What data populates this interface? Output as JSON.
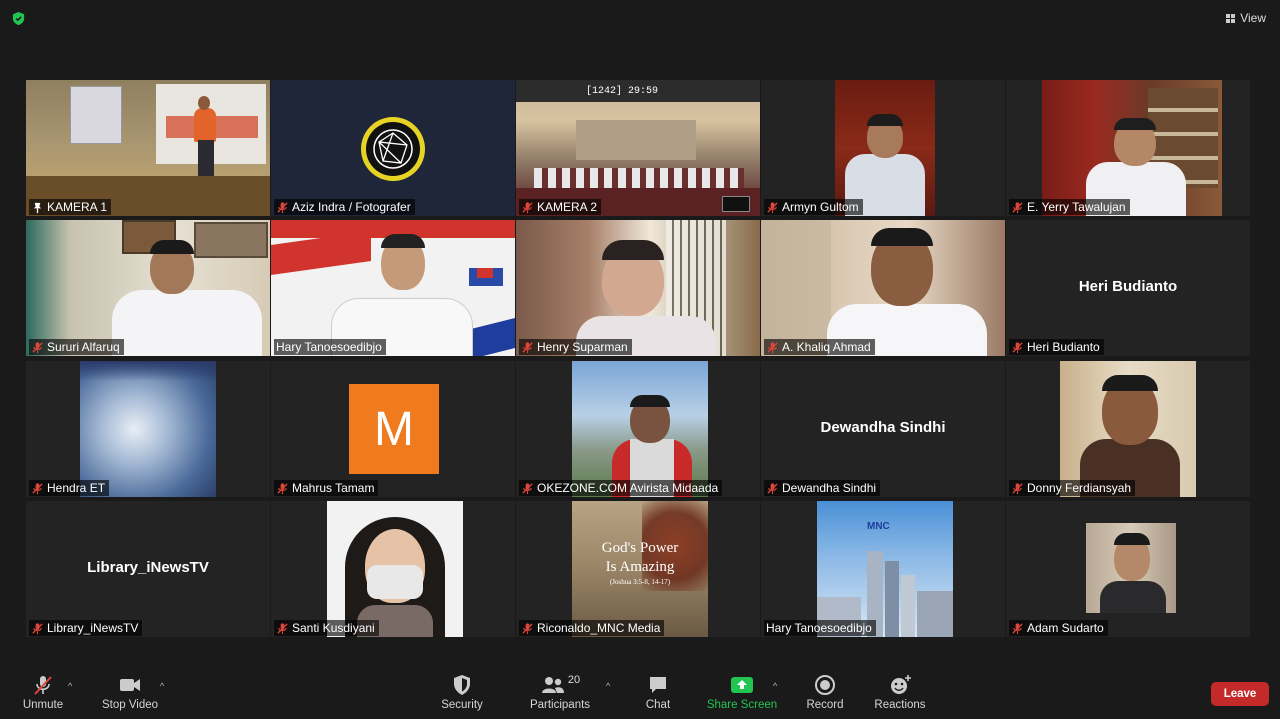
{
  "top": {
    "view_label": "View"
  },
  "tiles": [
    {
      "name": "KAMERA 1"
    },
    {
      "name": "Aziz Indra / Fotografer"
    },
    {
      "name": "KAMERA 2",
      "overlay_text": "[1242]   29:59"
    },
    {
      "name": "Armyn Gultom"
    },
    {
      "name": "E. Yerry Tawalujan"
    },
    {
      "name": "Sururi Alfaruq"
    },
    {
      "name": "Hary Tanoesoedibjo"
    },
    {
      "name": "Henry Suparman"
    },
    {
      "name": "A. Khaliq Ahmad"
    },
    {
      "name": "Heri Budianto",
      "display_name": "Heri Budianto"
    },
    {
      "name": "Hendra ET"
    },
    {
      "name": "Mahrus Tamam",
      "avatar_letter": "M"
    },
    {
      "name": "OKEZONE.COM Avirista Midaada"
    },
    {
      "name": "Dewandha Sindhi",
      "display_name": "Dewandha Sindhi"
    },
    {
      "name": "Donny Ferdiansyah"
    },
    {
      "name": "Library_iNewsTV",
      "display_name": "Library_iNewsTV"
    },
    {
      "name": "Santi Kusdiyani"
    },
    {
      "name": "Riconaldo_MNC Media",
      "image_text_1": "God's Power",
      "image_text_2": "Is Amazing",
      "image_text_3": "(Joshua 3:5-8, 14-17)"
    },
    {
      "name": "Hary Tanoesoedibjo",
      "logo_text": "MNC"
    },
    {
      "name": "Adam Sudarto"
    }
  ],
  "toolbar": {
    "unmute": "Unmute",
    "stop_video": "Stop Video",
    "security": "Security",
    "participants": "Participants",
    "participants_count": "20",
    "chat": "Chat",
    "share_screen": "Share Screen",
    "record": "Record",
    "reactions": "Reactions",
    "leave": "Leave"
  },
  "colors": {
    "background": "#1a1a1a",
    "tile": "#232323",
    "active_speaker": "#e8e15a",
    "share_green": "#23c552",
    "leave_red": "#c42a2a",
    "muted_red": "#e0453a",
    "avatar_orange": "#f07a1e"
  }
}
